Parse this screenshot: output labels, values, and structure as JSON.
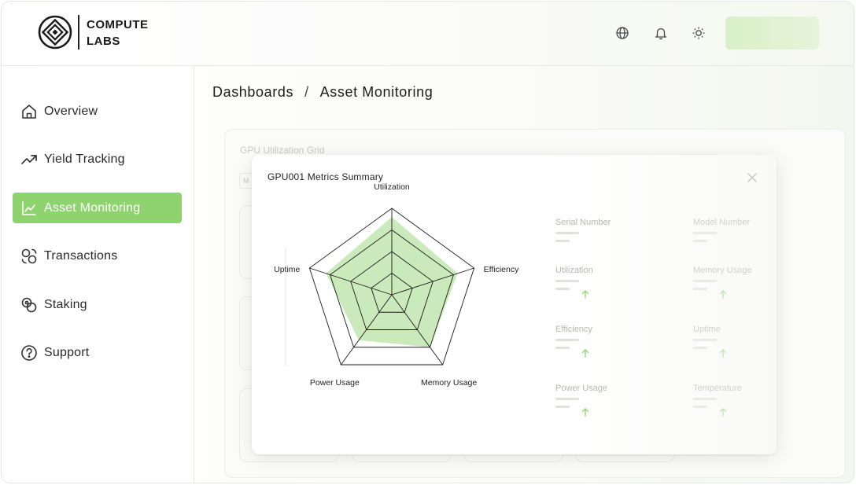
{
  "brand": {
    "line1": "COMPUTE",
    "line2": "LABS"
  },
  "header": {
    "icons": [
      "globe-icon",
      "bell-icon",
      "sun-icon"
    ],
    "accent_button_color": "#d9f0c8"
  },
  "sidebar": {
    "items": [
      {
        "label": "Overview",
        "icon": "home-icon",
        "active": false
      },
      {
        "label": "Yield Tracking",
        "icon": "trending-up-icon",
        "active": false
      },
      {
        "label": "Asset Monitoring",
        "icon": "line-chart-icon",
        "active": true
      },
      {
        "label": "Transactions",
        "icon": "coins-exchange-icon",
        "active": false
      },
      {
        "label": "Staking",
        "icon": "coins-icon",
        "active": false
      },
      {
        "label": "Support",
        "icon": "help-circle-icon",
        "active": false
      }
    ],
    "active_color": "#8ed36e"
  },
  "breadcrumb": {
    "root": "Dashboards",
    "separator": "/",
    "current": "Asset Monitoring"
  },
  "background_panel": {
    "title": "GPU Utilization Grid",
    "chip": "M"
  },
  "modal": {
    "title": "GPU001 Metrics Summary",
    "metrics": [
      {
        "label": "Serial Number",
        "trend": ""
      },
      {
        "label": "Model Number",
        "trend": ""
      },
      {
        "label": "Utilization",
        "trend": "up"
      },
      {
        "label": "Memory Usage",
        "trend": "up"
      },
      {
        "label": "Efficiency",
        "trend": "up"
      },
      {
        "label": "Uptime",
        "trend": "up"
      },
      {
        "label": "Power Usage",
        "trend": "up"
      },
      {
        "label": "Temperature",
        "trend": "up"
      }
    ]
  },
  "chart_data": {
    "type": "radar",
    "axes": [
      "Utilization",
      "Efficiency",
      "Memory Usage",
      "Power Usage",
      "Uptime"
    ],
    "series": [
      {
        "values": [
          0.9,
          0.8,
          0.75,
          0.65,
          0.8
        ],
        "color": "#a8dc8e"
      }
    ],
    "range": [
      0,
      1
    ],
    "grid_levels": 4
  }
}
